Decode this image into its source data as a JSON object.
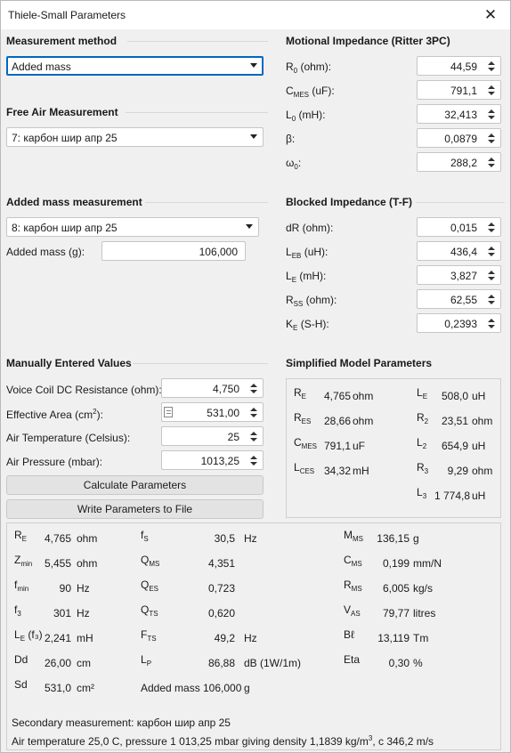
{
  "window": {
    "title": "Thiele-Small Parameters",
    "close_glyph": "✕"
  },
  "measurement_method": {
    "header": "Measurement method",
    "selected": "Added mass"
  },
  "free_air": {
    "header": "Free Air Measurement",
    "selected": "7: карбон шир апр 25"
  },
  "added_mass_measurement": {
    "header": "Added mass measurement",
    "selected": "8: карбон шир апр 25",
    "mass_label": "Added mass (g):",
    "mass_value": "106,000"
  },
  "motional": {
    "header": "Motional Impedance (Ritter 3PC)",
    "rows": [
      {
        "pre": "R",
        "sub": "0",
        "post": " (ohm):",
        "value": "44,59"
      },
      {
        "pre": "C",
        "sub": "MES",
        "post": " (uF):",
        "value": "791,1"
      },
      {
        "pre": "L",
        "sub": "0",
        "post": " (mH):",
        "value": "32,413"
      },
      {
        "pre": "β:",
        "sub": "",
        "post": "",
        "value": "0,0879"
      },
      {
        "pre": "ω",
        "sub": "0",
        "post": ":",
        "value": "288,2"
      }
    ]
  },
  "blocked": {
    "header": "Blocked Impedance (T-F)",
    "rows": [
      {
        "pre": "dR (ohm):",
        "sub": "",
        "post": "",
        "value": "0,015"
      },
      {
        "pre": "L",
        "sub": "EB",
        "post": " (uH):",
        "value": "436,4"
      },
      {
        "pre": "L",
        "sub": "E",
        "post": " (mH):",
        "value": "3,827"
      },
      {
        "pre": "R",
        "sub": "SS",
        "post": " (ohm):",
        "value": "62,55"
      },
      {
        "pre": "K",
        "sub": "E",
        "post": " (S-H):",
        "value": "0,2393"
      }
    ]
  },
  "manual": {
    "header": "Manually Entered Values",
    "dc_label": "Voice Coil DC Resistance (ohm):",
    "dc_value": "4,750",
    "area_pre": "Effective Area (cm",
    "area_sup": "2",
    "area_post": "):",
    "area_value": "531,00",
    "temp_label": "Air Temperature (Celsius):",
    "temp_value": "25",
    "press_label": "Air Pressure (mbar):",
    "press_value": "1013,25",
    "calc_button": "Calculate Parameters",
    "write_button": "Write Parameters to File"
  },
  "simplified": {
    "header": "Simplified Model Parameters",
    "left": [
      {
        "sym": "R",
        "sub": "E",
        "val": "4,765",
        "unit": "ohm"
      },
      {
        "sym": "R",
        "sub": "ES",
        "val": "28,66",
        "unit": "ohm"
      },
      {
        "sym": "C",
        "sub": "MES",
        "val": "791,1",
        "unit": "uF"
      },
      {
        "sym": "L",
        "sub": "CES",
        "val": "34,32",
        "unit": "mH"
      }
    ],
    "right": [
      {
        "sym": "L",
        "sub": "E",
        "val": "508,0",
        "unit": "uH"
      },
      {
        "sym": "R",
        "sub": "2",
        "val": "23,51",
        "unit": "ohm"
      },
      {
        "sym": "L",
        "sub": "2",
        "val": "654,9",
        "unit": "uH"
      },
      {
        "sym": "R",
        "sub": "3",
        "val": "9,29",
        "unit": "ohm"
      },
      {
        "sym": "L",
        "sub": "3",
        "val": "1 774,8",
        "unit": "uH"
      }
    ]
  },
  "results": {
    "col1": [
      {
        "sym": "R",
        "sub": "E",
        "extra": "",
        "val": "4,765",
        "unit": "ohm"
      },
      {
        "sym": "Z",
        "sub": "min",
        "extra": "",
        "val": "5,455",
        "unit": "ohm"
      },
      {
        "sym": "f",
        "sub": "min",
        "extra": "",
        "val": "90",
        "unit": "Hz"
      },
      {
        "sym": "f",
        "sub": "3",
        "extra": "",
        "val": "301",
        "unit": "Hz"
      },
      {
        "sym": "L",
        "sub": "E",
        "extra": " (f₃)",
        "val": "2,241",
        "unit": "mH"
      },
      {
        "sym": "Dd",
        "sub": "",
        "extra": "",
        "val": "26,00",
        "unit": "cm"
      },
      {
        "sym": "Sd",
        "sub": "",
        "extra": "",
        "val": "531,0",
        "unit": "cm²"
      }
    ],
    "col2": [
      {
        "sym": "f",
        "sub": "S",
        "val": "30,5",
        "unit": "Hz"
      },
      {
        "sym": "Q",
        "sub": "MS",
        "val": "4,351",
        "unit": ""
      },
      {
        "sym": "Q",
        "sub": "ES",
        "val": "0,723",
        "unit": ""
      },
      {
        "sym": "Q",
        "sub": "TS",
        "val": "0,620",
        "unit": ""
      },
      {
        "sym": "F",
        "sub": "TS",
        "val": "49,2",
        "unit": "Hz"
      },
      {
        "sym": "L",
        "sub": "P",
        "val": "86,88",
        "unit": "dB (1W/1m)"
      }
    ],
    "added_mass_label": "Added mass",
    "added_mass_val": "106,000",
    "added_mass_unit": "g",
    "col3": [
      {
        "sym": "M",
        "sub": "MS",
        "val": "136,15",
        "unit": "g"
      },
      {
        "sym": "C",
        "sub": "MS",
        "val": "0,199",
        "unit": "mm/N"
      },
      {
        "sym": "R",
        "sub": "MS",
        "val": "6,005",
        "unit": "kg/s"
      },
      {
        "sym": "V",
        "sub": "AS",
        "val": "79,77",
        "unit": "litres"
      },
      {
        "sym": "Bℓ",
        "sub": "",
        "val": "13,119",
        "unit": "Tm"
      },
      {
        "sym": "Eta",
        "sub": "",
        "val": "0,30",
        "unit": "%"
      }
    ],
    "secondary": "Secondary measurement: карбон шир апр 25",
    "air_pre": "Air temperature 25,0 C, pressure 1 013,25 mbar giving density 1,1839 kg/m",
    "air_sup": "3",
    "air_post": ", c 346,2 m/s"
  }
}
